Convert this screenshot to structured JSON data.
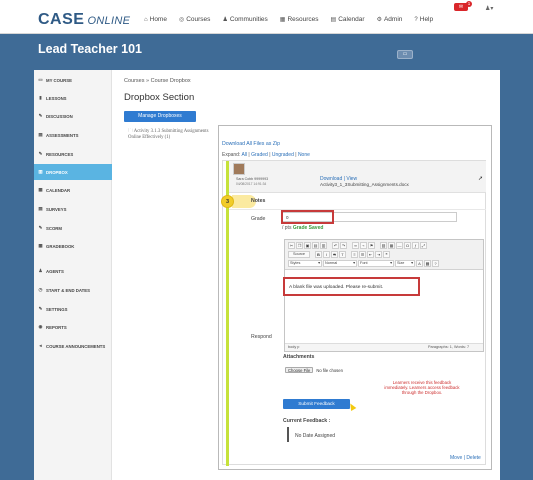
{
  "app": {
    "logo_main": "CASE",
    "logo_sub": "ONLINE",
    "notification_count": "1",
    "user_menu": "▾"
  },
  "nav": [
    {
      "label": "Home",
      "icon": "home-icon",
      "glyph": "⌂"
    },
    {
      "label": "Courses",
      "icon": "courses-icon",
      "glyph": "◎"
    },
    {
      "label": "Communities",
      "icon": "communities-icon",
      "glyph": "♟"
    },
    {
      "label": "Resources",
      "icon": "resources-icon",
      "glyph": "▦"
    },
    {
      "label": "Calendar",
      "icon": "calendar-icon",
      "glyph": "▤"
    },
    {
      "label": "Admin",
      "icon": "admin-icon",
      "glyph": "⚙"
    },
    {
      "label": "Help",
      "icon": "help-icon",
      "glyph": "?"
    }
  ],
  "course": {
    "title": "Lead Teacher 101",
    "collapse_label": "▭"
  },
  "sidebar": {
    "items": [
      {
        "label": "MY COURSE",
        "glyph": "▭",
        "icon": "my-course-icon",
        "active": false
      },
      {
        "label": "LESSONS",
        "glyph": "▮",
        "icon": "lessons-icon",
        "active": false
      },
      {
        "label": "DISCUSSION",
        "glyph": "✎",
        "icon": "discussion-icon",
        "active": false
      },
      {
        "label": "ASSESSMENTS",
        "glyph": "▤",
        "icon": "assessments-icon",
        "active": false
      },
      {
        "label": "RESOURCES",
        "glyph": "✎",
        "icon": "resources-icon",
        "active": false
      },
      {
        "label": "DROPBOX",
        "glyph": "▥",
        "icon": "dropbox-icon",
        "active": true
      },
      {
        "label": "CALENDAR",
        "glyph": "▦",
        "icon": "calendar-icon",
        "active": false
      },
      {
        "label": "SURVEYS",
        "glyph": "▤",
        "icon": "surveys-icon",
        "active": false
      },
      {
        "label": "SCORM",
        "glyph": "✎",
        "icon": "scorm-icon",
        "active": false
      },
      {
        "label": "GRADEBOOK",
        "glyph": "▦",
        "icon": "gradebook-icon",
        "active": false
      },
      {
        "label": "AGENTS",
        "glyph": "♟",
        "icon": "agents-icon",
        "active": false
      },
      {
        "label": "START & END DATES",
        "glyph": "◷",
        "icon": "dates-icon",
        "active": false
      },
      {
        "label": "SETTINGS",
        "glyph": "✎",
        "icon": "settings-icon",
        "active": false
      },
      {
        "label": "REPORTS",
        "glyph": "◉",
        "icon": "reports-icon",
        "active": false
      },
      {
        "label": "COURSE ANNOUNCEMENTS",
        "glyph": "◂",
        "icon": "announcements-icon",
        "active": false
      }
    ]
  },
  "main": {
    "breadcrumb": "Courses » Course Dropbox",
    "section_title": "Dropbox Section",
    "manage_button": "Manage Dropboxes",
    "assignment_link": "Activity 3.1.3 Submitting Assignments Online Effectively (1)"
  },
  "grading": {
    "download_all": "Download All Files as Zip",
    "expand_prefix": "Expand:",
    "expand_options": [
      "All",
      "Graded",
      "Ungraded",
      "None"
    ],
    "student_name": "Sara Cobb 9999993",
    "submitted_date": "04/08/2017 14:91:34",
    "download_link": "Download",
    "view_link": "View",
    "file_name": "Activity3_1_3Submitting_Assignments.docx",
    "step_number": "3",
    "notes_label": "Notes",
    "grade_label": "Grade",
    "grade_value": "0",
    "grade_out_of": "/ pts",
    "grade_saved": "Grade Saved",
    "respond_label": "Respond",
    "editor_text": "A blank file was uploaded. Please re-submit.",
    "editor_footer_body": "body p",
    "editor_footer_stats": "Paragraphs: 1, Words: 7",
    "toolbar_source": "Source",
    "toolbar_styles": "Styles",
    "toolbar_format": "Normal",
    "toolbar_font": "Font",
    "toolbar_size": "Size",
    "attachments_label": "Attachments",
    "choose_file": "Choose File",
    "no_file": "No file chosen",
    "callout": "Learners receive this feedback immediately. Learners access feedback through the Dropbox.",
    "submit_button": "Submit Feedback",
    "current_feedback_label": "Current Feedback :",
    "current_feedback_value": "No Date Assigned",
    "move_link": "Move",
    "delete_link": "Delete"
  },
  "colors": {
    "brand": "#2f5a85",
    "header_bg": "#3f6b96",
    "active_sidebar": "#5ab4e2",
    "button_blue": "#2f7bd1",
    "highlight_red": "#c73a3a",
    "success_green": "#3a9a3a"
  }
}
